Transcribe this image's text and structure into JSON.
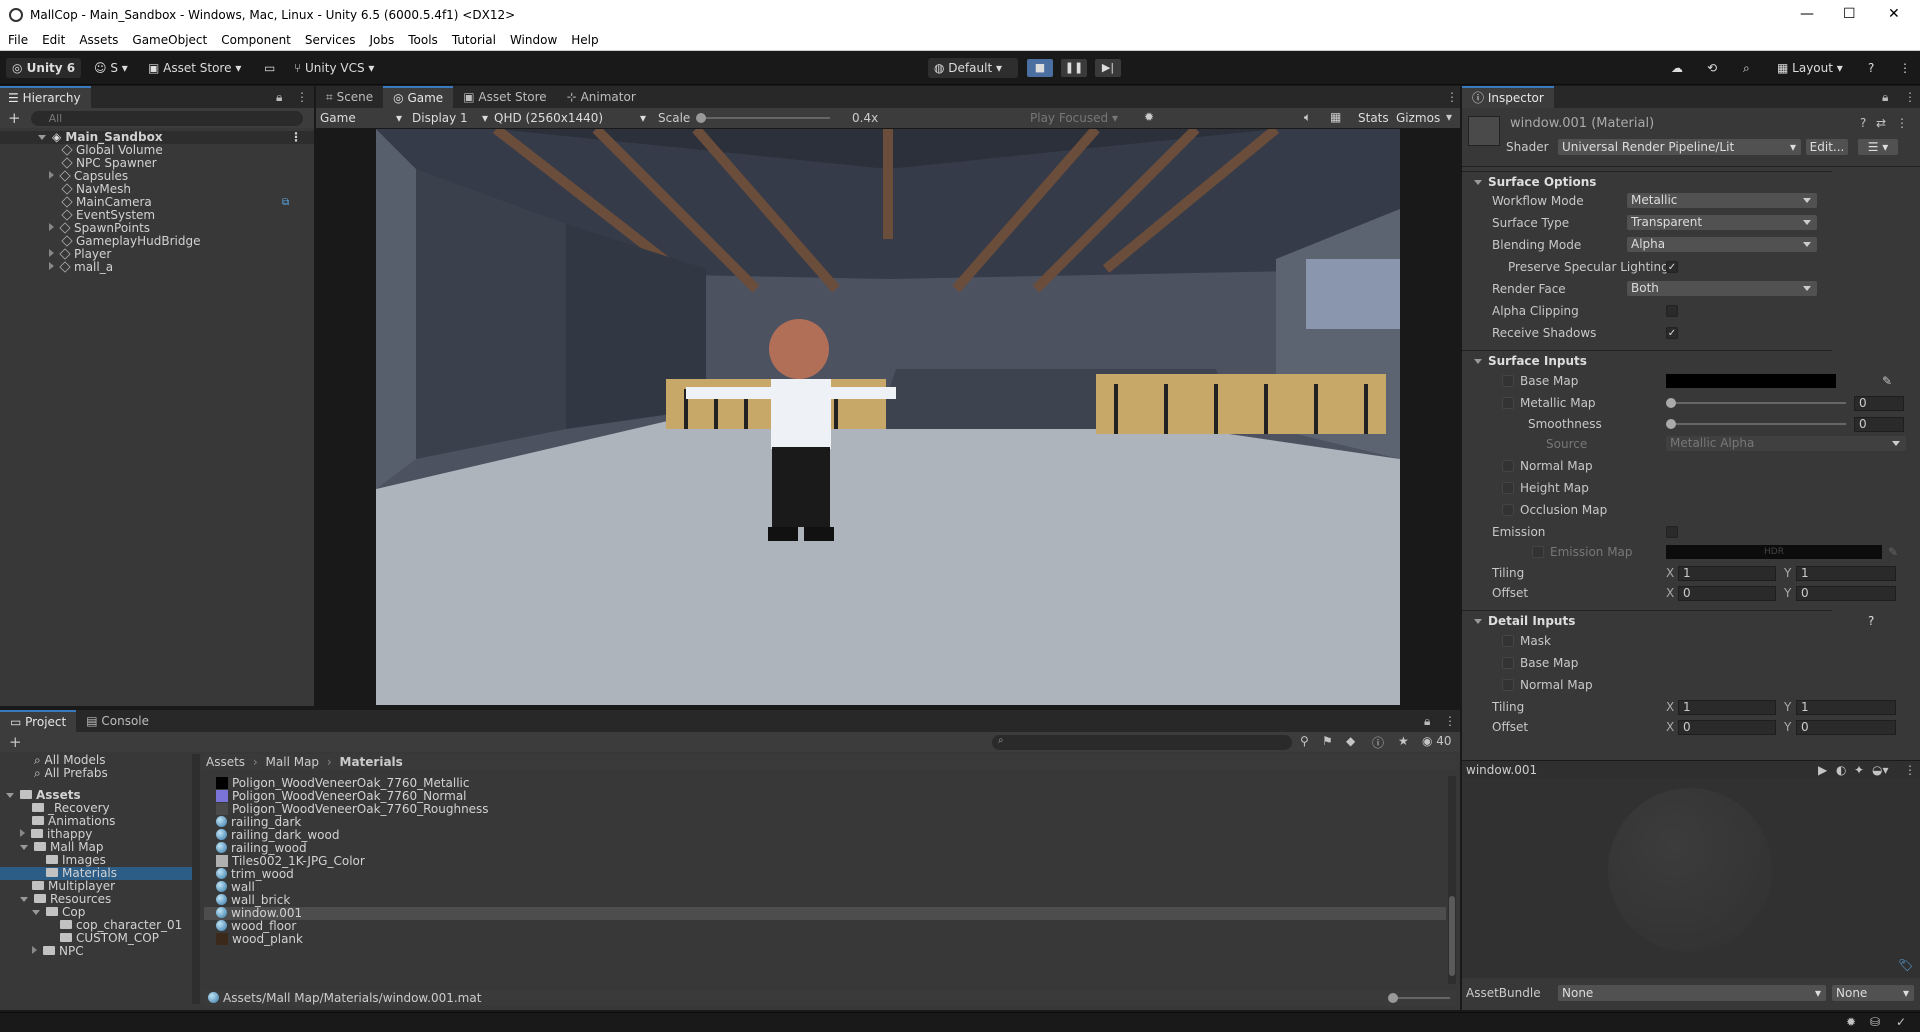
{
  "window": {
    "title": "MallCop - Main_Sandbox - Windows, Mac, Linux - Unity 6.5 (6000.5.4f1) <DX12>",
    "controls": [
      "—",
      "☐",
      "✕"
    ]
  },
  "menu": [
    "File",
    "Edit",
    "Assets",
    "GameObject",
    "Component",
    "Services",
    "Jobs",
    "Tools",
    "Tutorial",
    "Window",
    "Help"
  ],
  "toolbar": {
    "unity_label": "Unity 6",
    "account_label": "S",
    "asset_store_label": "Asset Store",
    "vcs_label": "Unity VCS",
    "layout_default": "Default",
    "layout_label": "Layout"
  },
  "hierarchy": {
    "tab": "Hierarchy",
    "search_placeholder": "All",
    "scene": "Main_Sandbox",
    "items": [
      {
        "label": "Global Volume",
        "expand": false
      },
      {
        "label": "NPC Spawner",
        "expand": false
      },
      {
        "label": "Capsules",
        "expand": true
      },
      {
        "label": "NavMesh",
        "expand": false
      },
      {
        "label": "MainCamera",
        "expand": false
      },
      {
        "label": "EventSystem",
        "expand": false
      },
      {
        "label": "SpawnPoints",
        "expand": true
      },
      {
        "label": "GameplayHudBridge",
        "expand": false
      },
      {
        "label": "Player",
        "expand": true
      },
      {
        "label": "mall_a",
        "expand": true
      }
    ]
  },
  "center_tabs": [
    "Scene",
    "Game",
    "Asset Store",
    "Animator"
  ],
  "game_bar": {
    "mode": "Game",
    "display": "Display 1",
    "resolution": "QHD (2560x1440)",
    "scale_label": "Scale",
    "scale_value": "0.4x",
    "play_focus": "Play Focused",
    "stats": "Stats",
    "gizmos": "Gizmos"
  },
  "project": {
    "tabs": [
      "Project",
      "Console"
    ],
    "count": "40",
    "favorites": [
      "All Models",
      "All Prefabs"
    ],
    "tree": [
      {
        "label": "Assets",
        "level": 0,
        "open": true
      },
      {
        "label": "_Recovery",
        "level": 1
      },
      {
        "label": "Animations",
        "level": 1
      },
      {
        "label": "ithappy",
        "level": 1,
        "expand": true
      },
      {
        "label": "Mall Map",
        "level": 1,
        "open": true
      },
      {
        "label": "Images",
        "level": 2
      },
      {
        "label": "Materials",
        "level": 2,
        "selected": true
      },
      {
        "label": "Multiplayer",
        "level": 1
      },
      {
        "label": "Resources",
        "level": 1,
        "open": true
      },
      {
        "label": "Cop",
        "level": 2,
        "open": true
      },
      {
        "label": "cop_character_01",
        "level": 3
      },
      {
        "label": "CUSTOM_COP",
        "level": 3
      },
      {
        "label": "NPC",
        "level": 2,
        "expand": true
      }
    ],
    "breadcrumb": [
      "Assets",
      "Mall Map",
      "Materials"
    ],
    "files": [
      {
        "label": "Poligon_WoodVeneerOak_7760_Metallic",
        "kind": "tex",
        "color": "#000000"
      },
      {
        "label": "Poligon_WoodVeneerOak_7760_Normal",
        "kind": "tex",
        "color": "#7a74d8"
      },
      {
        "label": "Poligon_WoodVeneerOak_7760_Roughness",
        "kind": "tex",
        "color": "#4a4a4a"
      },
      {
        "label": "railing_dark",
        "kind": "mat"
      },
      {
        "label": "railing_dark_wood",
        "kind": "mat"
      },
      {
        "label": "railing_wood",
        "kind": "mat"
      },
      {
        "label": "Tiles002_1K-JPG_Color",
        "kind": "tex",
        "color": "#b0b0b0"
      },
      {
        "label": "trim_wood",
        "kind": "mat"
      },
      {
        "label": "wall",
        "kind": "mat"
      },
      {
        "label": "wall_brick",
        "kind": "mat"
      },
      {
        "label": "window.001",
        "kind": "mat",
        "selected": true
      },
      {
        "label": "wood_floor",
        "kind": "mat"
      },
      {
        "label": "wood_plank",
        "kind": "tex",
        "color": "#3b2a1c"
      }
    ],
    "path": "Assets/Mall Map/Materials/window.001.mat"
  },
  "inspector": {
    "tab": "Inspector",
    "object_name": "window.001 (Material)",
    "shader_label": "Shader",
    "shader_value": "Universal Render Pipeline/Lit",
    "edit_label": "Edit...",
    "surface_options": "Surface Options",
    "workflow_label": "Workflow Mode",
    "workflow_value": "Metallic",
    "surface_type_label": "Surface Type",
    "surface_type_value": "Transparent",
    "blending_label": "Blending Mode",
    "blending_value": "Alpha",
    "preserve_label": "Preserve Specular Lighting",
    "render_face_label": "Render Face",
    "render_face_value": "Both",
    "alpha_clip_label": "Alpha Clipping",
    "receive_shadows_label": "Receive Shadows",
    "surface_inputs": "Surface Inputs",
    "base_map": "Base Map",
    "metallic_map": "Metallic Map",
    "metallic_value": "0",
    "smoothness": "Smoothness",
    "smoothness_value": "0",
    "source_label": "Source",
    "source_value": "Metallic Alpha",
    "normal_map": "Normal Map",
    "height_map": "Height Map",
    "occlusion_map": "Occlusion Map",
    "emission": "Emission",
    "emission_map": "Emission Map",
    "hdr": "HDR",
    "tiling": "Tiling",
    "offset": "Offset",
    "x": "X",
    "y": "Y",
    "tiling_x": "1",
    "tiling_y": "1",
    "offset_x": "0",
    "offset_y": "0",
    "detail_inputs": "Detail Inputs",
    "mask": "Mask",
    "detail_base_map": "Base Map",
    "detail_normal_map": "Normal Map",
    "detail_tiling_x": "1",
    "detail_tiling_y": "1",
    "detail_offset_x": "0",
    "detail_offset_y": "0",
    "preview_name": "window.001",
    "asset_bundle_label": "AssetBundle",
    "asset_bundle_value": "None",
    "asset_bundle_variant": "None"
  }
}
